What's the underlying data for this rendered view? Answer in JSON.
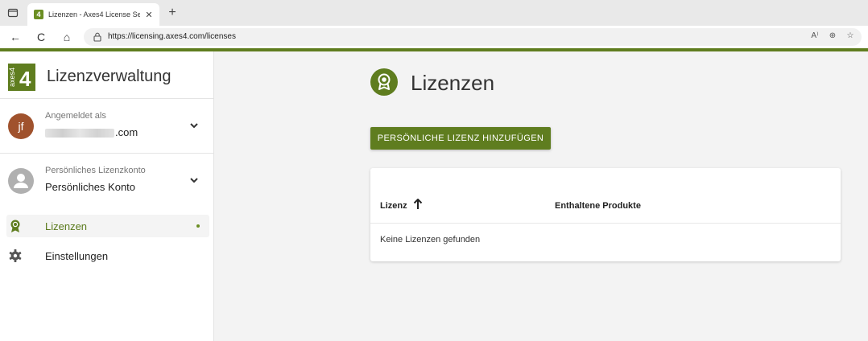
{
  "browser": {
    "tab_title": "Lizenzen - Axes4 License Server",
    "tab_close": "✕",
    "new_tab": "+",
    "url": "https://licensing.axes4.com/licenses",
    "back": "←",
    "reload": "C",
    "home": "⌂",
    "read_aloud": "A⁾",
    "zoom": "⊕",
    "favorites": "☆"
  },
  "sidebar": {
    "app_title": "Lizenzverwaltung",
    "logo_text": "axes4",
    "user": {
      "caption": "Angemeldet als",
      "email_visible_suffix": ".com",
      "initials": "jf",
      "avatar_color": "#a0522d"
    },
    "account": {
      "caption": "Persönliches Lizenzkonto",
      "value": "Persönliches Konto",
      "avatar_color": "#b0b0b0"
    },
    "nav": [
      {
        "label": "Lizenzen",
        "active": true,
        "icon": "award-icon"
      },
      {
        "label": "Einstellungen",
        "active": false,
        "icon": "gear-icon"
      }
    ]
  },
  "main": {
    "title": "Lizenzen",
    "add_button": "PERSÖNLICHE LIZENZ HINZUFÜGEN",
    "table": {
      "columns": [
        "Lizenz",
        "Enthaltene Produkte"
      ],
      "sort": "ascending",
      "empty_message": "Keine Lizenzen gefunden"
    }
  },
  "colors": {
    "accent": "#5f7d1f",
    "accent_text": "#5a7a1c"
  }
}
